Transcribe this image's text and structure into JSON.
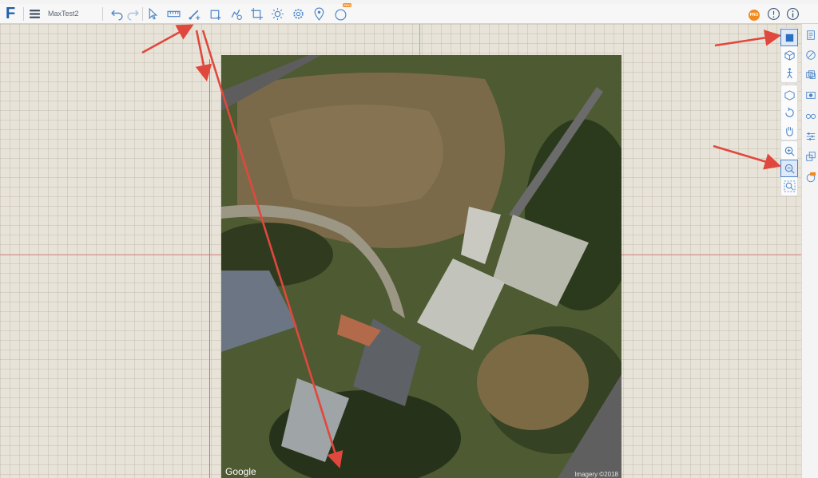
{
  "app": {
    "logo": "F",
    "project_name": "MaxTest2"
  },
  "toolbar": {
    "left_icons": [
      "menu-icon"
    ],
    "edit_icons": [
      "undo-icon",
      "redo-icon"
    ],
    "tool_icons": [
      "select-pointer-icon",
      "measure-icon",
      "draw-wall-icon",
      "add-room-icon",
      "add-furniture-icon",
      "crop-icon",
      "light-icon",
      "settings-gear-icon",
      "location-pin-icon",
      "360-view-icon"
    ],
    "right_icons": [
      "pro-badge-icon",
      "help-icon",
      "info-icon"
    ],
    "pro_label": "PRO",
    "pro_mini_label": "PRO"
  },
  "view_tools": {
    "group1": [
      "2d-view-icon",
      "3d-view-icon",
      "walkthrough-icon"
    ],
    "group2": [
      "orbit-icon",
      "rotate-icon",
      "pan-hand-icon"
    ],
    "group3": [
      "zoom-in-icon",
      "zoom-out-icon",
      "zoom-fit-icon"
    ]
  },
  "right_panel": {
    "icons": [
      "properties-icon",
      "materials-icon",
      "layers-icon",
      "camera-icon",
      "views-glasses-icon",
      "settings-sliders-icon",
      "floors-icon",
      "pro-objects-icon"
    ]
  },
  "aerial": {
    "watermark_left": "Google",
    "watermark_right": "Imagery ©2018"
  },
  "colors": {
    "accent": "#1f5fa8",
    "annotation_arrow": "#e0483e",
    "pro_orange": "#f28b1f"
  }
}
